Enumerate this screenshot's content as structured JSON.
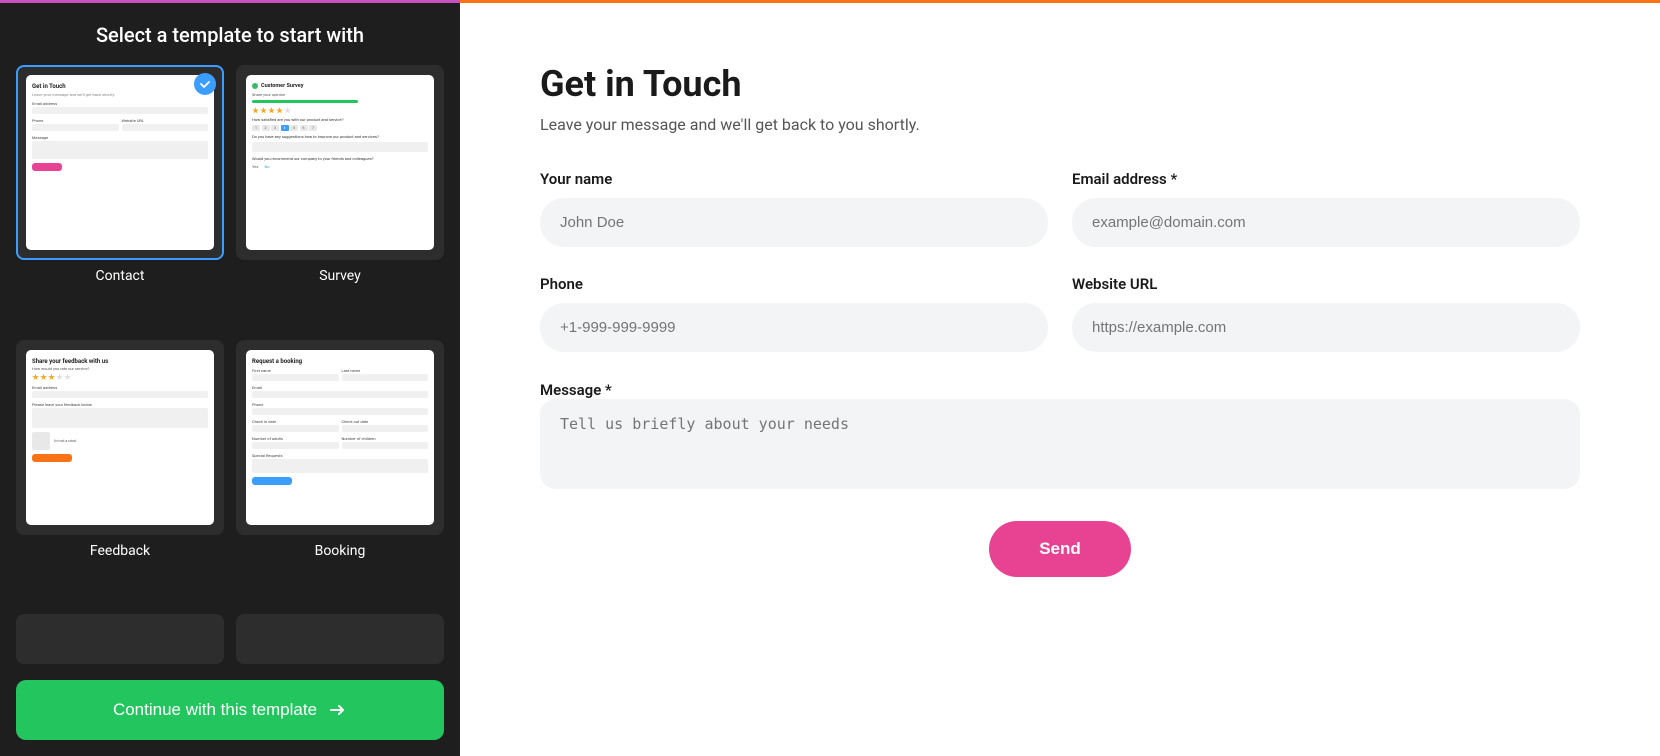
{
  "leftPanel": {
    "title": "Select a template to start with",
    "templates": [
      {
        "id": "contact",
        "label": "Contact",
        "selected": true
      },
      {
        "id": "survey",
        "label": "Survey",
        "selected": false
      },
      {
        "id": "feedback",
        "label": "Feedback",
        "selected": false
      },
      {
        "id": "booking",
        "label": "Booking",
        "selected": false
      }
    ],
    "continueButton": "Continue with this template"
  },
  "rightPanel": {
    "heading": "Get in Touch",
    "subheading": "Leave your message and we'll get back to you shortly.",
    "fields": {
      "yourName": {
        "label": "Your name",
        "placeholder": "John Doe"
      },
      "emailAddress": {
        "label": "Email address *",
        "placeholder": "example@domain.com"
      },
      "phone": {
        "label": "Phone",
        "placeholder": "+1-999-999-9999"
      },
      "websiteUrl": {
        "label": "Website URL",
        "placeholder": "https://example.com"
      },
      "message": {
        "label": "Message *",
        "placeholder": "Tell us briefly about your needs"
      }
    },
    "sendButton": "Send"
  }
}
